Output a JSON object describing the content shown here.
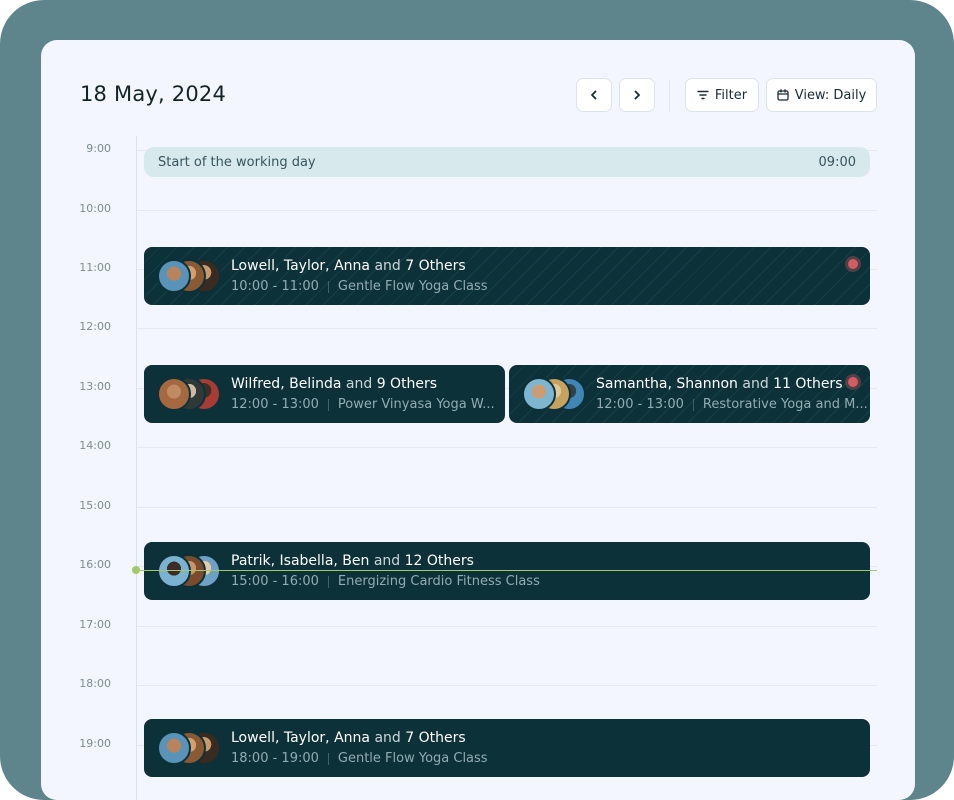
{
  "header": {
    "date": "18 May, 2024",
    "filter_label": "Filter",
    "view_label": "View: Daily"
  },
  "timeline": {
    "hours": [
      "9:00",
      "10:00",
      "11:00",
      "12:00",
      "13:00",
      "14:00",
      "15:00",
      "16:00",
      "17:00",
      "18:00",
      "19:00"
    ],
    "start_label": "Start of the working day",
    "start_time": "09:00",
    "accent_color": "#0c3139",
    "now_color": "#a4c96a",
    "alert_color": "#d35b63"
  },
  "events": [
    {
      "names": "Lowell, Taylor, Anna",
      "and_text": "and",
      "others": "7 Others",
      "time": "10:00 - 11:00",
      "title": "Gentle Flow Yoga Class"
    },
    {
      "names": "Wilfred, Belinda",
      "and_text": "and",
      "others": "9 Others",
      "time": "12:00 - 13:00",
      "title": "Power Vinyasa Yoga W..."
    },
    {
      "names": "Samantha, Shannon",
      "and_text": "and",
      "others": "11 Others",
      "time": "12:00 - 13:00",
      "title": "Restorative Yoga and M..."
    },
    {
      "names": "Patrik, Isabella, Ben",
      "and_text": "and",
      "others": "12 Others",
      "time": "15:00 - 16:00",
      "title": "Energizing Cardio Fitness Class"
    },
    {
      "names": "Lowell, Taylor, Anna",
      "and_text": "and",
      "others": "7 Others",
      "time": "18:00 - 19:00",
      "title": "Gentle Flow Yoga Class"
    }
  ]
}
